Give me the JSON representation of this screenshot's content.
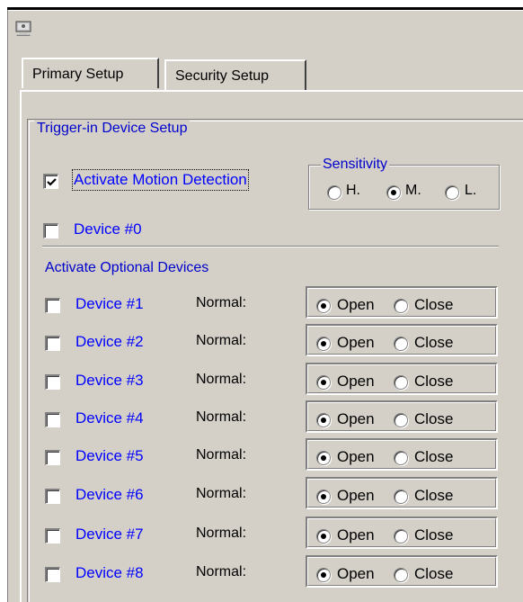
{
  "window": {
    "icon": "app-icon"
  },
  "tabs": [
    {
      "label": "Primary Setup"
    },
    {
      "label": "Security Setup"
    }
  ],
  "group_title": "Trigger-in Device Setup",
  "motion": {
    "label": "Activate Motion Detection",
    "checked": true
  },
  "sensitivity": {
    "title": "Sensitivity",
    "options": [
      {
        "label": "H."
      },
      {
        "label": "M."
      },
      {
        "label": "L."
      }
    ],
    "selected": "M."
  },
  "device0": {
    "label": "Device #0",
    "checked": false
  },
  "optional": {
    "title": "Activate Optional Devices",
    "normal_label": "Normal:",
    "open_label": "Open",
    "close_label": "Close",
    "devices": [
      {
        "label": "Device #1",
        "checked": false,
        "state": "Open"
      },
      {
        "label": "Device #2",
        "checked": false,
        "state": "Open"
      },
      {
        "label": "Device #3",
        "checked": false,
        "state": "Open"
      },
      {
        "label": "Device #4",
        "checked": false,
        "state": "Open"
      },
      {
        "label": "Device #5",
        "checked": false,
        "state": "Open"
      },
      {
        "label": "Device #6",
        "checked": false,
        "state": "Open"
      },
      {
        "label": "Device #7",
        "checked": false,
        "state": "Open"
      },
      {
        "label": "Device #8",
        "checked": false,
        "state": "Open"
      }
    ]
  },
  "colors": {
    "face": "#d4d0c8",
    "label_blue": "#0000ff",
    "title_blue": "#0000cc"
  }
}
